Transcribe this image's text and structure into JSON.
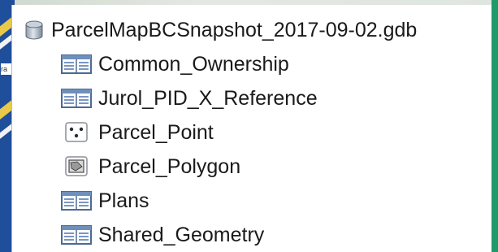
{
  "catalog": {
    "root": {
      "label": "ParcelMapBCSnapshot_2017-09-02.gdb",
      "icon": "geodatabase-icon"
    },
    "items": [
      {
        "label": "Common_Ownership",
        "icon": "table-icon"
      },
      {
        "label": "Jurol_PID_X_Reference",
        "icon": "table-icon"
      },
      {
        "label": "Parcel_Point",
        "icon": "point-feature-class-icon"
      },
      {
        "label": "Parcel_Polygon",
        "icon": "polygon-feature-class-icon"
      },
      {
        "label": "Plans",
        "icon": "table-icon"
      },
      {
        "label": "Shared_Geometry",
        "icon": "table-icon"
      }
    ]
  },
  "background_map": {
    "fragment_label": "ra"
  },
  "colors": {
    "text": "#1a1a1a",
    "icon_blue": "#5a7fb0",
    "map_blue": "#1f4e9a",
    "map_yellow": "#e8c94a"
  }
}
